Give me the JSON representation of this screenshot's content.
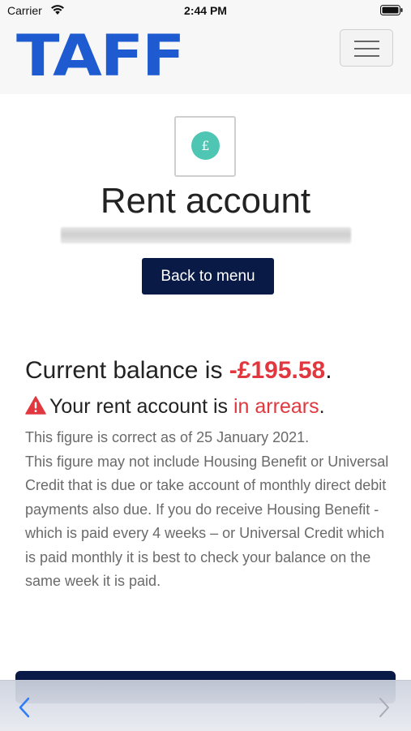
{
  "status_bar": {
    "carrier": "Carrier",
    "time": "2:44 PM"
  },
  "header": {
    "logo_text": "TAFF",
    "menu_icon": "hamburger-icon"
  },
  "page": {
    "icon": "pound-coin-icon",
    "icon_glyph": "£",
    "title": "Rent account",
    "back_button_label": "Back to menu"
  },
  "balance": {
    "prefix": "Current balance is ",
    "amount": "-£195.58",
    "suffix": "."
  },
  "arrears": {
    "prefix": "Your rent account is ",
    "status": "in arrears",
    "suffix": "."
  },
  "info": {
    "line1": "This figure is correct as of 25 January 2021.",
    "line2": "This figure may not include Housing Benefit or Universal Credit that is due or take account of monthly direct debit payments also due. If you do receive Housing Benefit - which is paid every 4 weeks – or Universal Credit which is paid monthly it is best to check your balance on the same week it is paid."
  },
  "colors": {
    "brand_blue": "#1e5bd0",
    "navy": "#0a1a47",
    "alert_red": "#e0383e",
    "teal": "#4fc6b3"
  }
}
